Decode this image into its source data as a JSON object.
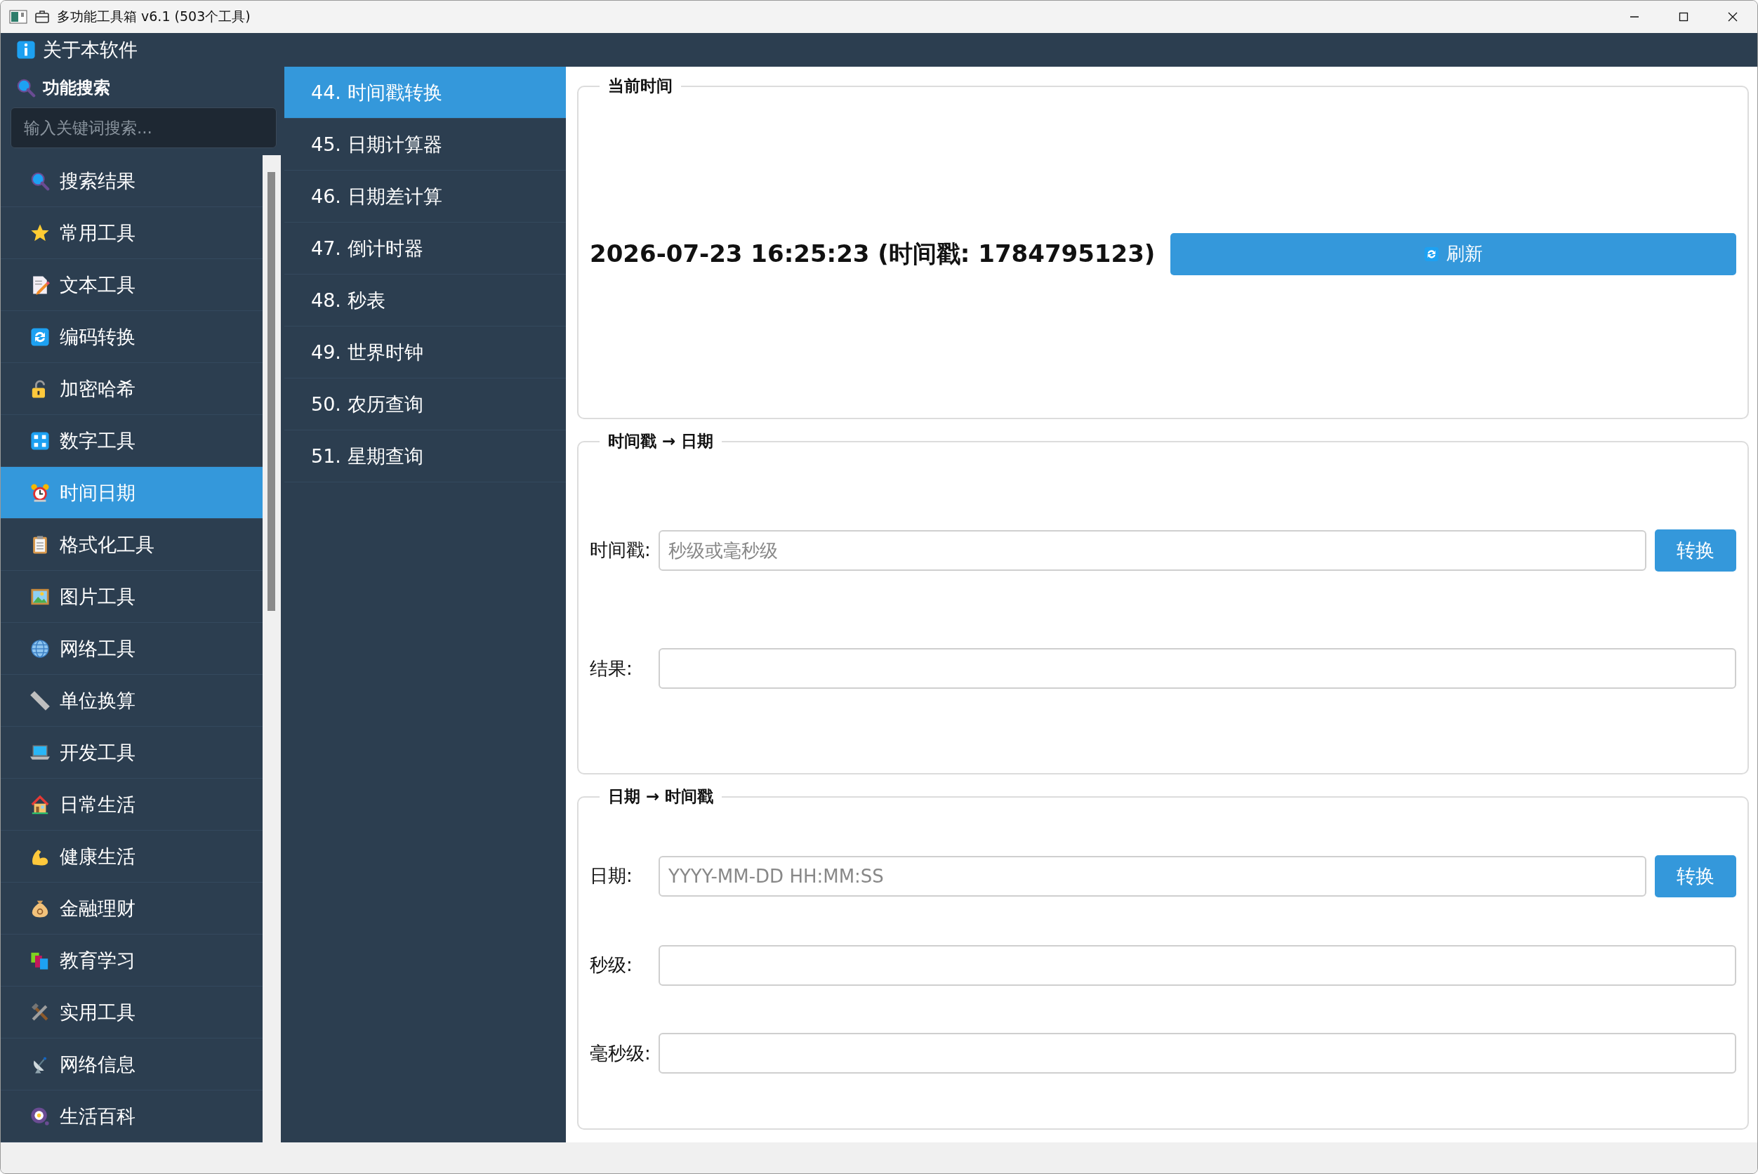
{
  "window": {
    "title": "多功能工具箱 v6.1 (503个工具)"
  },
  "about": {
    "label": "关于本软件"
  },
  "search": {
    "heading": "功能搜索",
    "placeholder": "输入关键词搜索..."
  },
  "sidebar": {
    "items": [
      {
        "label": "搜索结果",
        "selected": false
      },
      {
        "label": "常用工具",
        "selected": false
      },
      {
        "label": "文本工具",
        "selected": false
      },
      {
        "label": "编码转换",
        "selected": false
      },
      {
        "label": "加密哈希",
        "selected": false
      },
      {
        "label": "数字工具",
        "selected": false
      },
      {
        "label": "时间日期",
        "selected": true
      },
      {
        "label": "格式化工具",
        "selected": false
      },
      {
        "label": "图片工具",
        "selected": false
      },
      {
        "label": "网络工具",
        "selected": false
      },
      {
        "label": "单位换算",
        "selected": false
      },
      {
        "label": "开发工具",
        "selected": false
      },
      {
        "label": "日常生活",
        "selected": false
      },
      {
        "label": "健康生活",
        "selected": false
      },
      {
        "label": "金融理财",
        "selected": false
      },
      {
        "label": "教育学习",
        "selected": false
      },
      {
        "label": "实用工具",
        "selected": false
      },
      {
        "label": "网络信息",
        "selected": false
      },
      {
        "label": "生活百科",
        "selected": false
      }
    ]
  },
  "tools": {
    "items": [
      {
        "label": "44. 时间戳转换",
        "selected": true
      },
      {
        "label": "45. 日期计算器",
        "selected": false
      },
      {
        "label": "46. 日期差计算",
        "selected": false
      },
      {
        "label": "47. 倒计时器",
        "selected": false
      },
      {
        "label": "48. 秒表",
        "selected": false
      },
      {
        "label": "49. 世界时钟",
        "selected": false
      },
      {
        "label": "50. 农历查询",
        "selected": false
      },
      {
        "label": "51. 星期查询",
        "selected": false
      }
    ]
  },
  "current_time": {
    "title": "当前时间",
    "value": "2026-07-23 16:25:23 (时间戳: 1784795123)",
    "button": "刷新"
  },
  "ts_to_date": {
    "title": "时间戳 → 日期",
    "fields": [
      {
        "label": "时间戳:",
        "placeholder": "秒级或毫秒级",
        "button": "转换"
      },
      {
        "label": "结果:"
      }
    ]
  },
  "date_to_ts": {
    "title": "日期 → 时间戳",
    "fields": [
      {
        "label": "日期:",
        "placeholder": "YYYY-MM-DD HH:MM:SS",
        "button": "转换"
      },
      {
        "label": "秒级:"
      },
      {
        "label": "毫秒级:"
      }
    ]
  }
}
